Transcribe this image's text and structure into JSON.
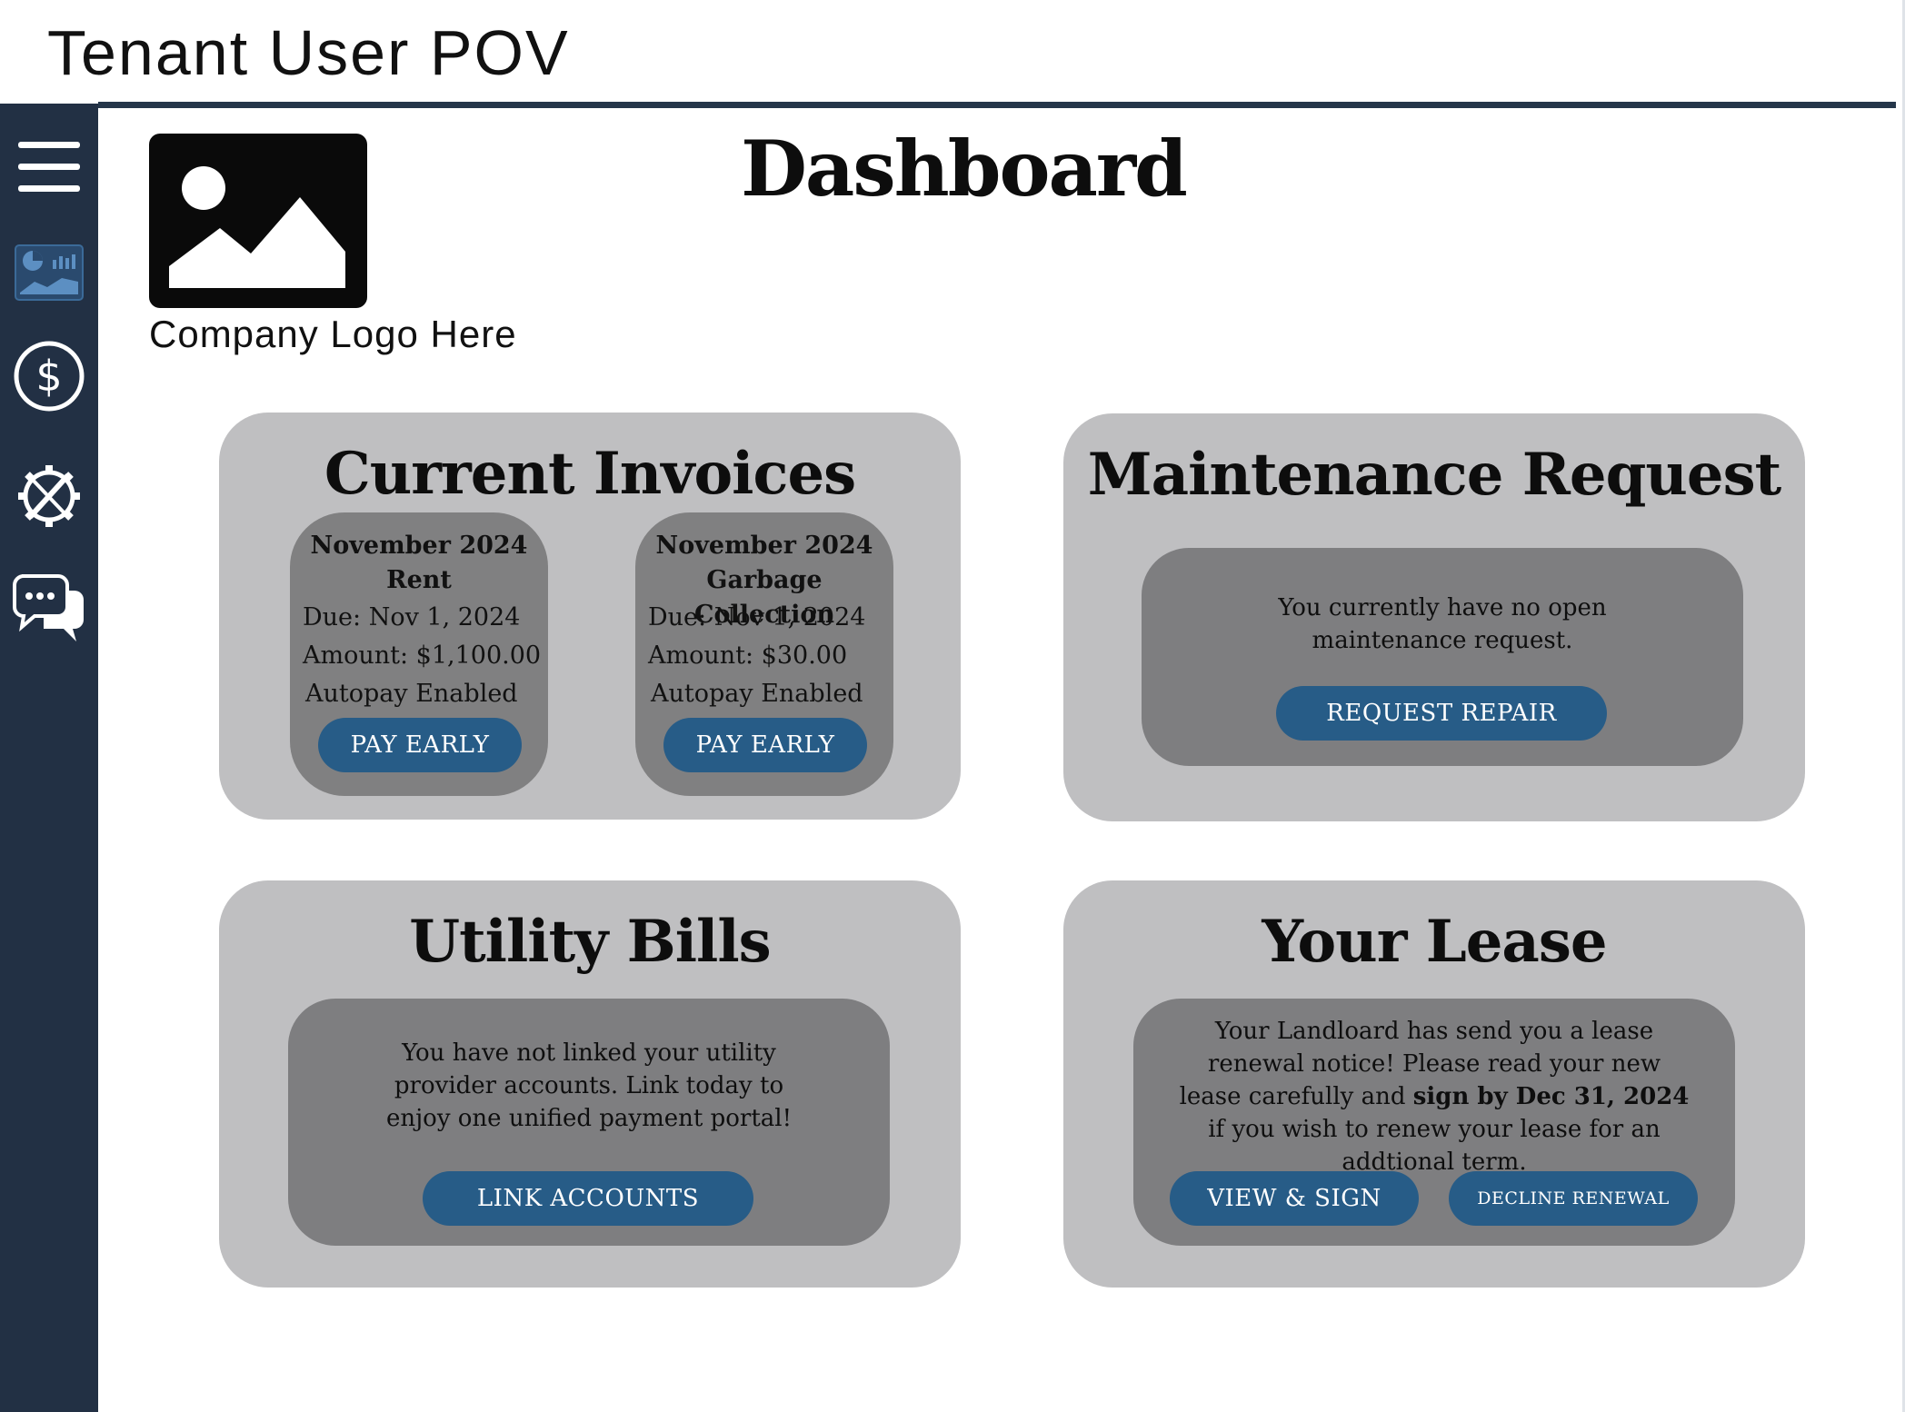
{
  "header": {
    "title": "Tenant User POV"
  },
  "page": {
    "title": "Dashboard"
  },
  "logo": {
    "label": "Company Logo Here"
  },
  "sidebar": {
    "items": [
      {
        "icon": "hamburger-menu-icon"
      },
      {
        "icon": "dashboard-icon"
      },
      {
        "icon": "dollar-icon"
      },
      {
        "icon": "maintenance-tools-icon"
      },
      {
        "icon": "chat-icon"
      }
    ]
  },
  "invoices": {
    "title": "Current Invoices",
    "items": [
      {
        "month": "November 2024",
        "name": "Rent",
        "due": "Due: Nov 1, 2024",
        "amount": "Amount: $1,100.00",
        "autopay": "Autopay Enabled",
        "button": "PAY EARLY"
      },
      {
        "month": "November 2024",
        "name": "Garbage Collection",
        "due": "Due: Nov 1, 2024",
        "amount": "Amount: $30.00",
        "autopay": "Autopay Enabled",
        "button": "PAY EARLY"
      }
    ]
  },
  "maintenance": {
    "title": "Maintenance Request",
    "message": "You currently have no open maintenance request.",
    "button": "REQUEST REPAIR"
  },
  "utility": {
    "title": "Utility Bills",
    "message": "You have not linked your utility provider accounts. Link today to enjoy one unified payment portal!",
    "button": "LINK ACCOUNTS"
  },
  "lease": {
    "title": "Your Lease",
    "message_part1": "Your Landloard has send you a lease renewal notice! Please read your new lease carefully and ",
    "message_bold": "sign by Dec 31, 2024",
    "message_part2": " if you wish to renew your lease for an addtional term.",
    "view_button": "VIEW & SIGN",
    "decline_button": "DECLINE RENEWAL"
  },
  "colors": {
    "sidebar": "#223044",
    "button": "#275c87",
    "card": "#bfbfc1",
    "panel": "#7e7e80"
  }
}
